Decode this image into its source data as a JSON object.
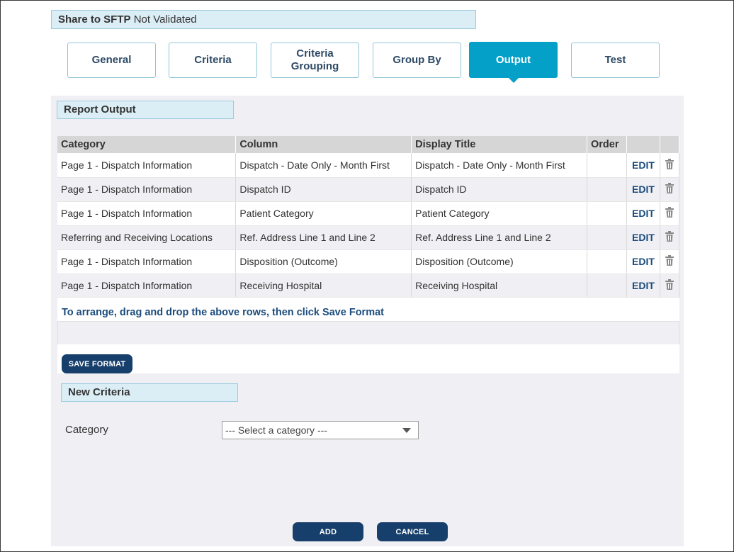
{
  "header": {
    "title_strong": "Share to SFTP",
    "title_rest": " Not Validated"
  },
  "tabs": [
    {
      "label": "General",
      "active": false
    },
    {
      "label": "Criteria",
      "active": false
    },
    {
      "label": "Criteria\nGrouping",
      "active": false
    },
    {
      "label": "Group By",
      "active": false
    },
    {
      "label": "Output",
      "active": true
    },
    {
      "label": "Test",
      "active": false
    }
  ],
  "report_output": {
    "section_label": "Report Output",
    "columns": [
      "Category",
      "Column",
      "Display Title",
      "Order",
      "",
      ""
    ],
    "rows": [
      {
        "category": "Page 1 - Dispatch Information",
        "column": "Dispatch - Date Only - Month First",
        "display_title": "Dispatch - Date Only - Month First",
        "order": "",
        "edit": "EDIT"
      },
      {
        "category": "Page 1 - Dispatch Information",
        "column": "Dispatch ID",
        "display_title": "Dispatch ID",
        "order": "",
        "edit": "EDIT"
      },
      {
        "category": "Page 1 - Dispatch Information",
        "column": "Patient Category",
        "display_title": "Patient Category",
        "order": "",
        "edit": "EDIT"
      },
      {
        "category": "Referring and Receiving Locations",
        "column": "Ref. Address Line 1 and Line 2",
        "display_title": "Ref. Address Line 1 and Line 2",
        "order": "",
        "edit": "EDIT"
      },
      {
        "category": "Page 1 - Dispatch Information",
        "column": "Disposition (Outcome)",
        "display_title": "Disposition (Outcome)",
        "order": "",
        "edit": "EDIT"
      },
      {
        "category": "Page 1 - Dispatch Information",
        "column": "Receiving Hospital",
        "display_title": "Receiving Hospital",
        "order": "",
        "edit": "EDIT"
      }
    ],
    "hint": "To arrange, drag and drop the above rows, then click Save Format",
    "save_button": "SAVE FORMAT"
  },
  "new_criteria": {
    "section_label": "New Criteria",
    "category_label": "Category",
    "category_select": {
      "selected": "--- Select a category ---",
      "icon": "chevron-down-icon"
    }
  },
  "actions": {
    "add": "ADD",
    "cancel": "CANCEL"
  },
  "colors": {
    "active_tab": "#04a0c8",
    "primary_button": "#173f6b",
    "link": "#1b4c7d",
    "section_bg": "#dbedf5"
  }
}
